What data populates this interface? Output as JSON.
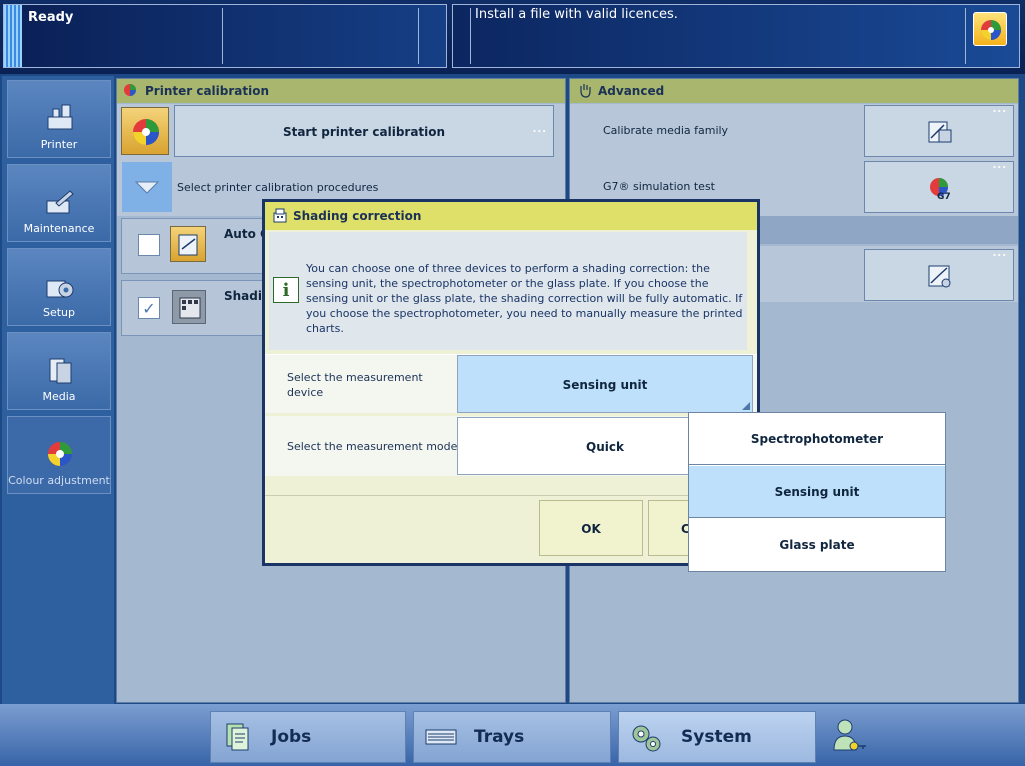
{
  "status": {
    "state": "Ready",
    "message": "Install a file with valid licences."
  },
  "nav": {
    "items": [
      {
        "label": "Printer"
      },
      {
        "label": "Maintenance"
      },
      {
        "label": "Setup"
      },
      {
        "label": "Media"
      },
      {
        "label": "Colour adjustment"
      }
    ]
  },
  "calibration": {
    "title": "Printer calibration",
    "start_label": "Start printer calibration",
    "select_label": "Select printer calibration procedures",
    "proc1": "Auto G",
    "proc2": "Shadin",
    "more": "...",
    "checkmark": "✓"
  },
  "advanced": {
    "title": "Advanced",
    "row1": "Calibrate media family",
    "row2": "G7® simulation test",
    "g7_badge": "G7"
  },
  "modal": {
    "title": "Shading correction",
    "info_glyph": "i",
    "info": "You can choose one of three devices to perform a shading correction: the sensing unit, the spectrophotometer or the glass plate. If you choose the sensing unit or the glass plate, the shading correction will be fully automatic. If you choose the spectrophotometer, you need to manually measure the printed charts.",
    "device_label": "Select the measurement device",
    "device_value": "Sensing unit",
    "mode_label": "Select the measurement mode",
    "mode_value": "Quick",
    "ok": "OK",
    "cancel": "C"
  },
  "dropdown": {
    "options": [
      "Spectrophotometer",
      "Sensing unit",
      "Glass plate"
    ],
    "selected": "Sensing unit"
  },
  "bottom": {
    "tabs": [
      {
        "label": "Jobs"
      },
      {
        "label": "Trays"
      },
      {
        "label": "System"
      }
    ]
  }
}
